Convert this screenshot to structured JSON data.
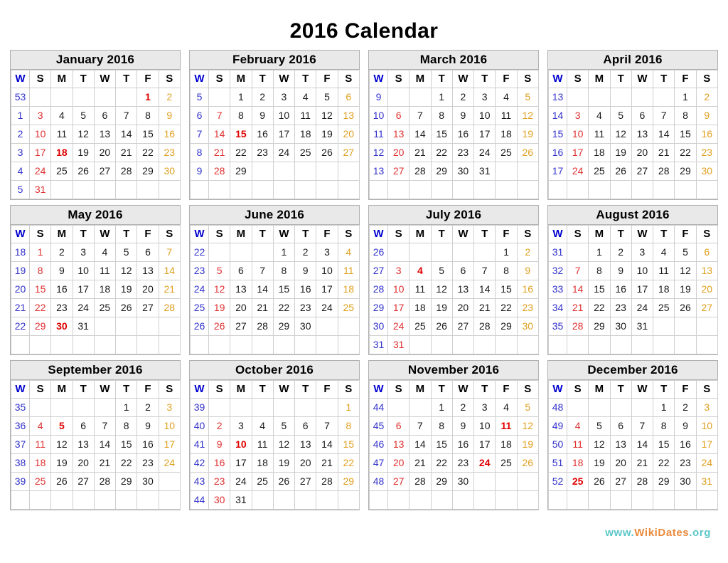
{
  "page": {
    "title": "2016 Calendar",
    "year": "2016"
  },
  "colors": {
    "week_number": "#3333cc",
    "sunday": "#e03030",
    "saturday": "#e0a020",
    "weekday": "#1a1a1a",
    "holiday": "#e00000",
    "header_bg": "#e9e9e9",
    "border": "#cfcfcf",
    "footer_teal": "#5cc6c9",
    "footer_orange": "#ea8a3c"
  },
  "weekday_headers": [
    "W",
    "S",
    "M",
    "T",
    "W",
    "T",
    "F",
    "S"
  ],
  "footer": {
    "www": "www.",
    "name": "WikiDates",
    "tld": ".org"
  },
  "months": [
    {
      "name": "January 2016",
      "weeks": [
        {
          "wk": "53",
          "days": [
            "",
            "",
            "",
            "",
            "",
            "1",
            "2"
          ],
          "holidays": [
            5
          ]
        },
        {
          "wk": "1",
          "days": [
            "3",
            "4",
            "5",
            "6",
            "7",
            "8",
            "9"
          ],
          "holidays": []
        },
        {
          "wk": "2",
          "days": [
            "10",
            "11",
            "12",
            "13",
            "14",
            "15",
            "16"
          ],
          "holidays": []
        },
        {
          "wk": "3",
          "days": [
            "17",
            "18",
            "19",
            "20",
            "21",
            "22",
            "23"
          ],
          "holidays": [
            1
          ]
        },
        {
          "wk": "4",
          "days": [
            "24",
            "25",
            "26",
            "27",
            "28",
            "29",
            "30"
          ],
          "holidays": []
        },
        {
          "wk": "5",
          "days": [
            "31",
            "",
            "",
            "",
            "",
            "",
            ""
          ],
          "holidays": []
        }
      ]
    },
    {
      "name": "February 2016",
      "weeks": [
        {
          "wk": "5",
          "days": [
            "",
            "1",
            "2",
            "3",
            "4",
            "5",
            "6"
          ],
          "holidays": []
        },
        {
          "wk": "6",
          "days": [
            "7",
            "8",
            "9",
            "10",
            "11",
            "12",
            "13"
          ],
          "holidays": []
        },
        {
          "wk": "7",
          "days": [
            "14",
            "15",
            "16",
            "17",
            "18",
            "19",
            "20"
          ],
          "holidays": [
            1
          ]
        },
        {
          "wk": "8",
          "days": [
            "21",
            "22",
            "23",
            "24",
            "25",
            "26",
            "27"
          ],
          "holidays": []
        },
        {
          "wk": "9",
          "days": [
            "28",
            "29",
            "",
            "",
            "",
            "",
            ""
          ],
          "holidays": []
        },
        {
          "wk": "",
          "days": [
            "",
            "",
            "",
            "",
            "",
            "",
            ""
          ],
          "holidays": []
        }
      ]
    },
    {
      "name": "March 2016",
      "weeks": [
        {
          "wk": "9",
          "days": [
            "",
            "",
            "1",
            "2",
            "3",
            "4",
            "5"
          ],
          "holidays": []
        },
        {
          "wk": "10",
          "days": [
            "6",
            "7",
            "8",
            "9",
            "10",
            "11",
            "12"
          ],
          "holidays": []
        },
        {
          "wk": "11",
          "days": [
            "13",
            "14",
            "15",
            "16",
            "17",
            "18",
            "19"
          ],
          "holidays": []
        },
        {
          "wk": "12",
          "days": [
            "20",
            "21",
            "22",
            "23",
            "24",
            "25",
            "26"
          ],
          "holidays": []
        },
        {
          "wk": "13",
          "days": [
            "27",
            "28",
            "29",
            "30",
            "31",
            "",
            ""
          ],
          "holidays": []
        },
        {
          "wk": "",
          "days": [
            "",
            "",
            "",
            "",
            "",
            "",
            ""
          ],
          "holidays": []
        }
      ]
    },
    {
      "name": "April 2016",
      "weeks": [
        {
          "wk": "13",
          "days": [
            "",
            "",
            "",
            "",
            "",
            "1",
            "2"
          ],
          "holidays": []
        },
        {
          "wk": "14",
          "days": [
            "3",
            "4",
            "5",
            "6",
            "7",
            "8",
            "9"
          ],
          "holidays": []
        },
        {
          "wk": "15",
          "days": [
            "10",
            "11",
            "12",
            "13",
            "14",
            "15",
            "16"
          ],
          "holidays": []
        },
        {
          "wk": "16",
          "days": [
            "17",
            "18",
            "19",
            "20",
            "21",
            "22",
            "23"
          ],
          "holidays": []
        },
        {
          "wk": "17",
          "days": [
            "24",
            "25",
            "26",
            "27",
            "28",
            "29",
            "30"
          ],
          "holidays": []
        },
        {
          "wk": "",
          "days": [
            "",
            "",
            "",
            "",
            "",
            "",
            ""
          ],
          "holidays": []
        }
      ]
    },
    {
      "name": "May 2016",
      "weeks": [
        {
          "wk": "18",
          "days": [
            "1",
            "2",
            "3",
            "4",
            "5",
            "6",
            "7"
          ],
          "holidays": []
        },
        {
          "wk": "19",
          "days": [
            "8",
            "9",
            "10",
            "11",
            "12",
            "13",
            "14"
          ],
          "holidays": []
        },
        {
          "wk": "20",
          "days": [
            "15",
            "16",
            "17",
            "18",
            "19",
            "20",
            "21"
          ],
          "holidays": []
        },
        {
          "wk": "21",
          "days": [
            "22",
            "23",
            "24",
            "25",
            "26",
            "27",
            "28"
          ],
          "holidays": []
        },
        {
          "wk": "22",
          "days": [
            "29",
            "30",
            "31",
            "",
            "",
            "",
            ""
          ],
          "holidays": [
            1
          ]
        },
        {
          "wk": "",
          "days": [
            "",
            "",
            "",
            "",
            "",
            "",
            ""
          ],
          "holidays": []
        }
      ]
    },
    {
      "name": "June 2016",
      "weeks": [
        {
          "wk": "22",
          "days": [
            "",
            "",
            "",
            "1",
            "2",
            "3",
            "4"
          ],
          "holidays": []
        },
        {
          "wk": "23",
          "days": [
            "5",
            "6",
            "7",
            "8",
            "9",
            "10",
            "11"
          ],
          "holidays": []
        },
        {
          "wk": "24",
          "days": [
            "12",
            "13",
            "14",
            "15",
            "16",
            "17",
            "18"
          ],
          "holidays": []
        },
        {
          "wk": "25",
          "days": [
            "19",
            "20",
            "21",
            "22",
            "23",
            "24",
            "25"
          ],
          "holidays": []
        },
        {
          "wk": "26",
          "days": [
            "26",
            "27",
            "28",
            "29",
            "30",
            "",
            ""
          ],
          "holidays": []
        },
        {
          "wk": "",
          "days": [
            "",
            "",
            "",
            "",
            "",
            "",
            ""
          ],
          "holidays": []
        }
      ]
    },
    {
      "name": "July 2016",
      "weeks": [
        {
          "wk": "26",
          "days": [
            "",
            "",
            "",
            "",
            "",
            "1",
            "2"
          ],
          "holidays": []
        },
        {
          "wk": "27",
          "days": [
            "3",
            "4",
            "5",
            "6",
            "7",
            "8",
            "9"
          ],
          "holidays": [
            1
          ]
        },
        {
          "wk": "28",
          "days": [
            "10",
            "11",
            "12",
            "13",
            "14",
            "15",
            "16"
          ],
          "holidays": []
        },
        {
          "wk": "29",
          "days": [
            "17",
            "18",
            "19",
            "20",
            "21",
            "22",
            "23"
          ],
          "holidays": []
        },
        {
          "wk": "30",
          "days": [
            "24",
            "25",
            "26",
            "27",
            "28",
            "29",
            "30"
          ],
          "holidays": []
        },
        {
          "wk": "31",
          "days": [
            "31",
            "",
            "",
            "",
            "",
            "",
            ""
          ],
          "holidays": []
        }
      ]
    },
    {
      "name": "August 2016",
      "weeks": [
        {
          "wk": "31",
          "days": [
            "",
            "1",
            "2",
            "3",
            "4",
            "5",
            "6"
          ],
          "holidays": []
        },
        {
          "wk": "32",
          "days": [
            "7",
            "8",
            "9",
            "10",
            "11",
            "12",
            "13"
          ],
          "holidays": []
        },
        {
          "wk": "33",
          "days": [
            "14",
            "15",
            "16",
            "17",
            "18",
            "19",
            "20"
          ],
          "holidays": []
        },
        {
          "wk": "34",
          "days": [
            "21",
            "22",
            "23",
            "24",
            "25",
            "26",
            "27"
          ],
          "holidays": []
        },
        {
          "wk": "35",
          "days": [
            "28",
            "29",
            "30",
            "31",
            "",
            "",
            ""
          ],
          "holidays": []
        },
        {
          "wk": "",
          "days": [
            "",
            "",
            "",
            "",
            "",
            "",
            ""
          ],
          "holidays": []
        }
      ]
    },
    {
      "name": "September 2016",
      "weeks": [
        {
          "wk": "35",
          "days": [
            "",
            "",
            "",
            "",
            "1",
            "2",
            "3"
          ],
          "holidays": []
        },
        {
          "wk": "36",
          "days": [
            "4",
            "5",
            "6",
            "7",
            "8",
            "9",
            "10"
          ],
          "holidays": [
            1
          ]
        },
        {
          "wk": "37",
          "days": [
            "11",
            "12",
            "13",
            "14",
            "15",
            "16",
            "17"
          ],
          "holidays": []
        },
        {
          "wk": "38",
          "days": [
            "18",
            "19",
            "20",
            "21",
            "22",
            "23",
            "24"
          ],
          "holidays": []
        },
        {
          "wk": "39",
          "days": [
            "25",
            "26",
            "27",
            "28",
            "29",
            "30",
            ""
          ],
          "holidays": []
        },
        {
          "wk": "",
          "days": [
            "",
            "",
            "",
            "",
            "",
            "",
            ""
          ],
          "holidays": []
        }
      ]
    },
    {
      "name": "October 2016",
      "weeks": [
        {
          "wk": "39",
          "days": [
            "",
            "",
            "",
            "",
            "",
            "",
            "1"
          ],
          "holidays": []
        },
        {
          "wk": "40",
          "days": [
            "2",
            "3",
            "4",
            "5",
            "6",
            "7",
            "8"
          ],
          "holidays": []
        },
        {
          "wk": "41",
          "days": [
            "9",
            "10",
            "11",
            "12",
            "13",
            "14",
            "15"
          ],
          "holidays": [
            1
          ]
        },
        {
          "wk": "42",
          "days": [
            "16",
            "17",
            "18",
            "19",
            "20",
            "21",
            "22"
          ],
          "holidays": []
        },
        {
          "wk": "43",
          "days": [
            "23",
            "24",
            "25",
            "26",
            "27",
            "28",
            "29"
          ],
          "holidays": []
        },
        {
          "wk": "44",
          "days": [
            "30",
            "31",
            "",
            "",
            "",
            "",
            ""
          ],
          "holidays": []
        }
      ]
    },
    {
      "name": "November 2016",
      "weeks": [
        {
          "wk": "44",
          "days": [
            "",
            "",
            "1",
            "2",
            "3",
            "4",
            "5"
          ],
          "holidays": []
        },
        {
          "wk": "45",
          "days": [
            "6",
            "7",
            "8",
            "9",
            "10",
            "11",
            "12"
          ],
          "holidays": [
            5
          ]
        },
        {
          "wk": "46",
          "days": [
            "13",
            "14",
            "15",
            "16",
            "17",
            "18",
            "19"
          ],
          "holidays": []
        },
        {
          "wk": "47",
          "days": [
            "20",
            "21",
            "22",
            "23",
            "24",
            "25",
            "26"
          ],
          "holidays": [
            4
          ]
        },
        {
          "wk": "48",
          "days": [
            "27",
            "28",
            "29",
            "30",
            "",
            "",
            ""
          ],
          "holidays": []
        },
        {
          "wk": "",
          "days": [
            "",
            "",
            "",
            "",
            "",
            "",
            ""
          ],
          "holidays": []
        }
      ]
    },
    {
      "name": "December 2016",
      "weeks": [
        {
          "wk": "48",
          "days": [
            "",
            "",
            "",
            "",
            "1",
            "2",
            "3"
          ],
          "holidays": []
        },
        {
          "wk": "49",
          "days": [
            "4",
            "5",
            "6",
            "7",
            "8",
            "9",
            "10"
          ],
          "holidays": []
        },
        {
          "wk": "50",
          "days": [
            "11",
            "12",
            "13",
            "14",
            "15",
            "16",
            "17"
          ],
          "holidays": []
        },
        {
          "wk": "51",
          "days": [
            "18",
            "19",
            "20",
            "21",
            "22",
            "23",
            "24"
          ],
          "holidays": []
        },
        {
          "wk": "52",
          "days": [
            "25",
            "26",
            "27",
            "28",
            "29",
            "30",
            "31"
          ],
          "holidays": [
            0
          ]
        },
        {
          "wk": "",
          "days": [
            "",
            "",
            "",
            "",
            "",
            "",
            ""
          ],
          "holidays": []
        }
      ]
    }
  ]
}
